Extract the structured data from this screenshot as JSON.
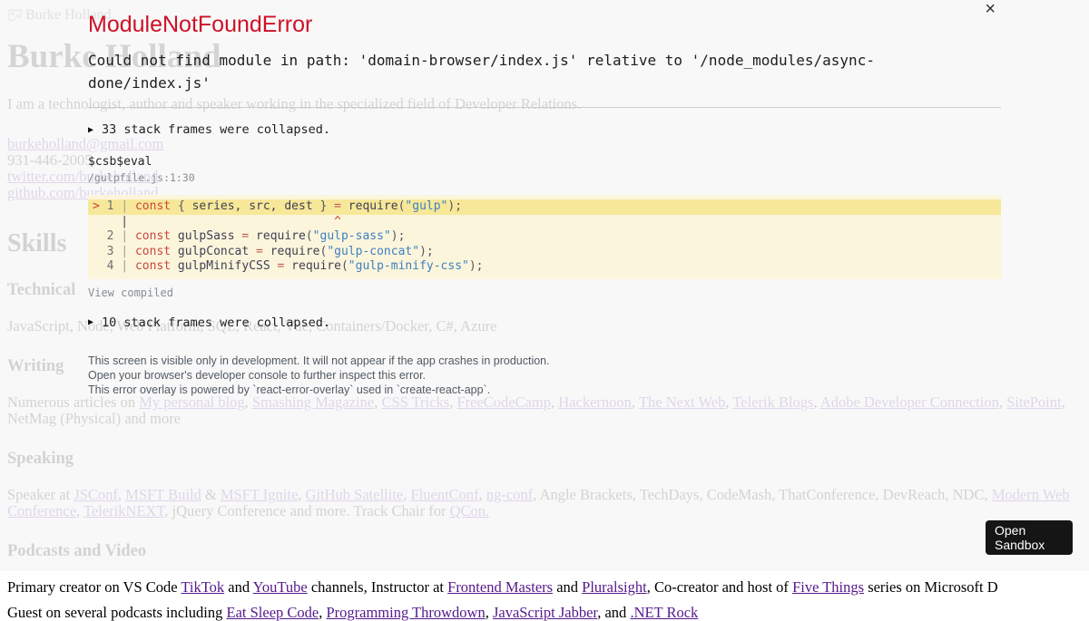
{
  "colors": {
    "error_red": "#ce1126",
    "code_frame_bg": "#fbf5db",
    "code_frame_highlight": "#f7e899",
    "sandbox_button_bg": "#151515",
    "link_purple": "#551A8B"
  },
  "icons": {
    "close": "×",
    "collapsed_marker": "▶",
    "broken_image": "broken-image-icon"
  },
  "page": {
    "broken_image_alt": "Burke Holland",
    "title": "Burke Holland",
    "intro": "I am a technologist, author and speaker working in the specialized field of Developer Relations.",
    "contacts": [
      {
        "text": "burkeholland@gmail.com",
        "link": true
      },
      {
        "text": "931-446-2005",
        "link": false
      },
      {
        "text": "twitter.com/burkeholland",
        "link": true
      },
      {
        "text": "github.com/burkeholland",
        "link": true
      }
    ],
    "skills_heading": "Skills",
    "technical_heading": "Technical",
    "technical_text": "JavaScript, Node, Web Platform, SQL, React, Vue, Containers/Docker, C#, Azure",
    "writing_heading": "Writing",
    "writing_segments": [
      {
        "text": "Numerous articles on "
      },
      {
        "text": "My personal blog",
        "link": true
      },
      {
        "text": ", "
      },
      {
        "text": "Smashing Magazine",
        "link": true
      },
      {
        "text": ", "
      },
      {
        "text": "CSS Tricks",
        "link": true
      },
      {
        "text": ", "
      },
      {
        "text": "FreeCodeCamp",
        "link": true
      },
      {
        "text": ", "
      },
      {
        "text": "Hackernoon",
        "link": true
      },
      {
        "text": ", "
      },
      {
        "text": "The Next Web",
        "link": true
      },
      {
        "text": ", "
      },
      {
        "text": "Telerik Blogs",
        "link": true
      },
      {
        "text": ", "
      },
      {
        "text": "Adobe Developer Connection",
        "link": true
      },
      {
        "text": ", "
      },
      {
        "text": "SitePoint",
        "link": true
      },
      {
        "text": ", NetMag (Physical) and more"
      }
    ],
    "speaking_heading": "Speaking",
    "speaking_segments": [
      {
        "text": "Speaker at "
      },
      {
        "text": "JSConf",
        "link": true
      },
      {
        "text": ", "
      },
      {
        "text": "MSFT Build",
        "link": true
      },
      {
        "text": " & "
      },
      {
        "text": "MSFT Ignite",
        "link": true
      },
      {
        "text": ", "
      },
      {
        "text": "GitHub Satellite",
        "link": true
      },
      {
        "text": ", "
      },
      {
        "text": "FluentConf",
        "link": true
      },
      {
        "text": ", "
      },
      {
        "text": "ng-conf",
        "link": true
      },
      {
        "text": ", Angle Brackets, TechDays, CodeMash, ThatConference, DevReach, NDC, "
      },
      {
        "text": "Modern Web Conference",
        "link": true
      },
      {
        "text": ", "
      },
      {
        "text": "TelerikNEXT",
        "link": true
      },
      {
        "text": ", jQuery Conference and more. Track Chair for "
      },
      {
        "text": "QCon.",
        "link": true
      }
    ],
    "podcasts_heading": "Podcasts and Video",
    "podcasts_segments": [
      {
        "text": "Primary creator on VS Code "
      },
      {
        "text": "TikTok",
        "link": true
      },
      {
        "text": " and "
      },
      {
        "text": "YouTube",
        "link": true
      },
      {
        "text": " channels, Instructor at "
      },
      {
        "text": "Frontend Masters",
        "link": true
      },
      {
        "text": " and "
      },
      {
        "text": "Pluralsight",
        "link": true
      },
      {
        "text": ", Co-creator and host of "
      },
      {
        "text": "Five Things",
        "link": true
      },
      {
        "text": " series on Microsoft D"
      }
    ],
    "podcasts2_segments": [
      {
        "text": "Guest on several podcasts including "
      },
      {
        "text": "Eat Sleep Code",
        "link": true
      },
      {
        "text": ", "
      },
      {
        "text": "Programming Throwdown",
        "link": true
      },
      {
        "text": ", "
      },
      {
        "text": "JavaScript Jabber",
        "link": true
      },
      {
        "text": ", and "
      },
      {
        "text": ".NET Rock",
        "link": true
      }
    ]
  },
  "overlay": {
    "error_type": "ModuleNotFoundError",
    "message": "Could not find module in path: 'domain-browser/index.js' relative to '/node_modules/async-done/index.js'",
    "collapsed_top": "33 stack frames were collapsed.",
    "frame_fn": "$csb$eval",
    "frame_loc": "/gulpfile.js:1:30",
    "view_compiled": "View compiled",
    "collapsed_bottom": "10 stack frames were collapsed.",
    "footer": [
      "This screen is visible only in development. It will not appear if the app crashes in production.",
      "Open your browser's developer console to further inspect this error.",
      "This error overlay is powered by `react-error-overlay` used in `create-react-app`."
    ],
    "open_sandbox_label": "Open Sandbox",
    "code_frame": {
      "lines": [
        {
          "h": true,
          "t": [
            [
              "mk",
              "> "
            ],
            [
              "ln",
              "1 "
            ],
            [
              "pp",
              "| "
            ],
            [
              "kw",
              "const"
            ],
            [
              "pl",
              " "
            ],
            [
              "pu",
              "{"
            ],
            [
              "pl",
              " series, src, dest "
            ],
            [
              "pu",
              "}"
            ],
            [
              "pl",
              " "
            ],
            [
              "op",
              "="
            ],
            [
              "pl",
              " "
            ],
            [
              "fn",
              "require"
            ],
            [
              "pu",
              "("
            ],
            [
              "st",
              "\"gulp\""
            ],
            [
              "pu",
              ");"
            ]
          ]
        },
        {
          "h": false,
          "t": [
            [
              "pl",
              "    | "
            ],
            [
              "pl",
              "                            "
            ],
            [
              "ca",
              "^"
            ]
          ]
        },
        {
          "h": false,
          "t": [
            [
              "pl",
              "  "
            ],
            [
              "ln",
              "2 "
            ],
            [
              "pp",
              "| "
            ],
            [
              "kw",
              "const"
            ],
            [
              "pl",
              " gulpSass "
            ],
            [
              "op",
              "="
            ],
            [
              "pl",
              " "
            ],
            [
              "fn",
              "require"
            ],
            [
              "pu",
              "("
            ],
            [
              "st",
              "\"gulp-sass\""
            ],
            [
              "pu",
              ");"
            ]
          ]
        },
        {
          "h": false,
          "t": [
            [
              "pl",
              "  "
            ],
            [
              "ln",
              "3 "
            ],
            [
              "pp",
              "| "
            ],
            [
              "kw",
              "const"
            ],
            [
              "pl",
              " gulpConcat "
            ],
            [
              "op",
              "="
            ],
            [
              "pl",
              " "
            ],
            [
              "fn",
              "require"
            ],
            [
              "pu",
              "("
            ],
            [
              "st",
              "\"gulp-concat\""
            ],
            [
              "pu",
              ");"
            ]
          ]
        },
        {
          "h": false,
          "t": [
            [
              "pl",
              "  "
            ],
            [
              "ln",
              "4 "
            ],
            [
              "pp",
              "| "
            ],
            [
              "kw",
              "const"
            ],
            [
              "pl",
              " gulpMinifyCSS "
            ],
            [
              "op",
              "="
            ],
            [
              "pl",
              " "
            ],
            [
              "fn",
              "require"
            ],
            [
              "pu",
              "("
            ],
            [
              "st",
              "\"gulp-minify-css\""
            ],
            [
              "pu",
              ");"
            ]
          ]
        }
      ]
    }
  }
}
